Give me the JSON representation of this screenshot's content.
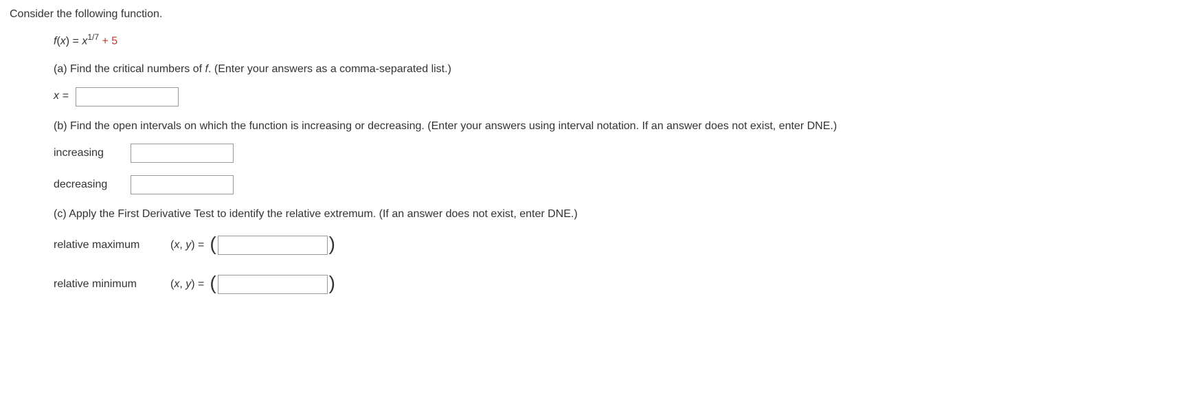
{
  "intro": "Consider the following function.",
  "function": {
    "lhs": "f",
    "lhs_paren_var": "x",
    "eq": " = ",
    "rhs_base": "x",
    "rhs_exp": "1/7",
    "plus": " + 5"
  },
  "partA": {
    "label": "(a) Find the critical numbers of ",
    "f_italic": "f",
    "after": ". (Enter your answers as a comma-separated list.)",
    "x_equals": "x ="
  },
  "partB": {
    "prompt": "(b) Find the open intervals on which the function is increasing or decreasing. (Enter your answers using interval notation. If an answer does not exist, enter DNE.)",
    "increasing": "increasing",
    "decreasing": "decreasing"
  },
  "partC": {
    "prompt": "(c) Apply the First Derivative Test to identify the relative extremum. (If an answer does not exist, enter DNE.)",
    "rel_max": "relative maximum",
    "rel_min": "relative minimum",
    "xy_label_x": "x",
    "xy_label_sep": ", ",
    "xy_label_y": "y",
    "xy_eq": " = "
  }
}
